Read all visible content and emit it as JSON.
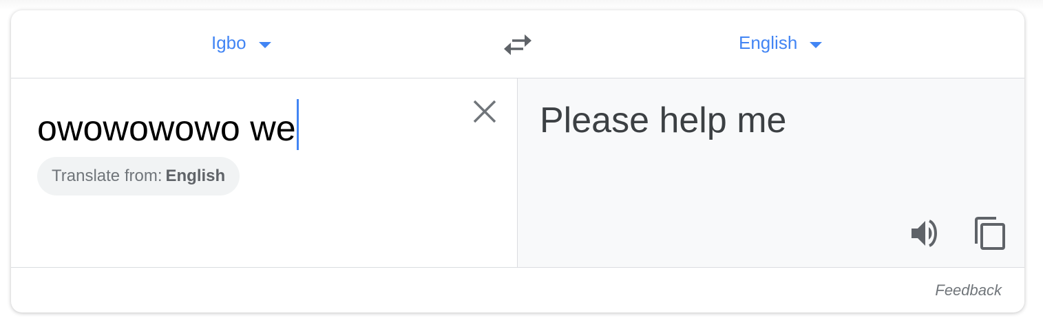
{
  "header": {
    "source_language": "Igbo",
    "target_language": "English",
    "swap_icon": "swap-arrows-icon",
    "dropdown_icon": "caret-down-icon"
  },
  "source": {
    "text": "owowowowo we",
    "clear_icon": "close-icon",
    "chip_prefix": "Translate from:",
    "chip_language": "English"
  },
  "target": {
    "text": "Please help me",
    "speaker_icon": "speaker-icon",
    "copy_icon": "copy-icon"
  },
  "footer": {
    "feedback_label": "Feedback"
  },
  "colors": {
    "accent": "#4285f4",
    "target_bg": "#f8f9fa",
    "chip_bg": "#f1f3f4",
    "icon_gray": "#5f6368"
  }
}
